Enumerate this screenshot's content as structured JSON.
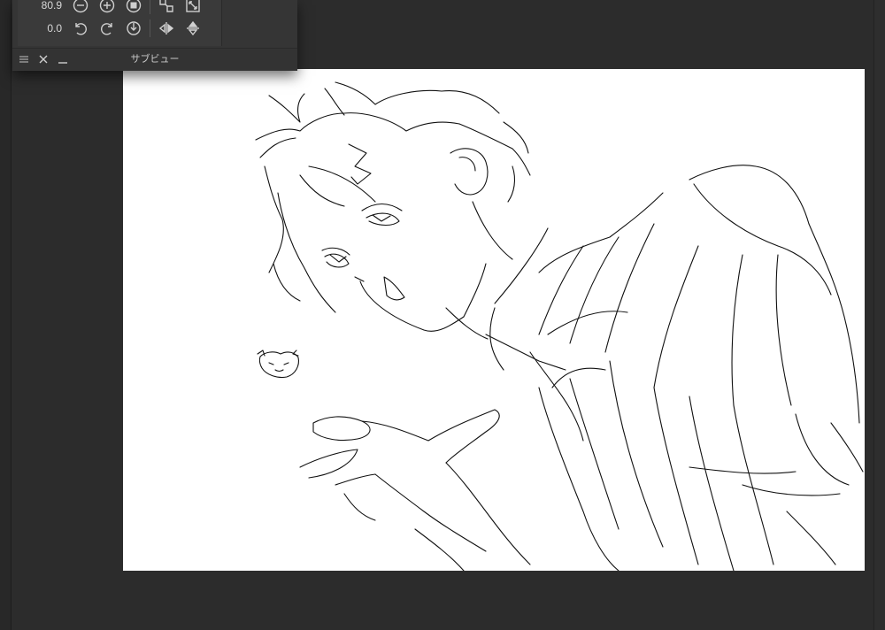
{
  "subview": {
    "title": "サブビュー",
    "zoom_value": "80.9",
    "rotation_value": "0.0",
    "zoom_buttons": [
      {
        "name": "zoom-out-icon"
      },
      {
        "name": "zoom-in-icon"
      },
      {
        "name": "fit-screen-icon"
      },
      {
        "name": "fit-navigator-icon"
      },
      {
        "name": "actual-size-icon"
      }
    ],
    "rotate_buttons": [
      {
        "name": "rotate-left-icon"
      },
      {
        "name": "rotate-right-icon"
      },
      {
        "name": "reset-rotation-icon"
      },
      {
        "name": "flip-horizontal-icon"
      },
      {
        "name": "flip-vertical-icon"
      }
    ],
    "bar_buttons": [
      "menu-icon",
      "close-icon",
      "minimize-icon"
    ]
  },
  "colors": {
    "workspace": "#2c2c2c",
    "panel": "#3a3a3a",
    "canvas": "#ffffff",
    "icon": "#d0d0d0",
    "ink": "#111111"
  }
}
